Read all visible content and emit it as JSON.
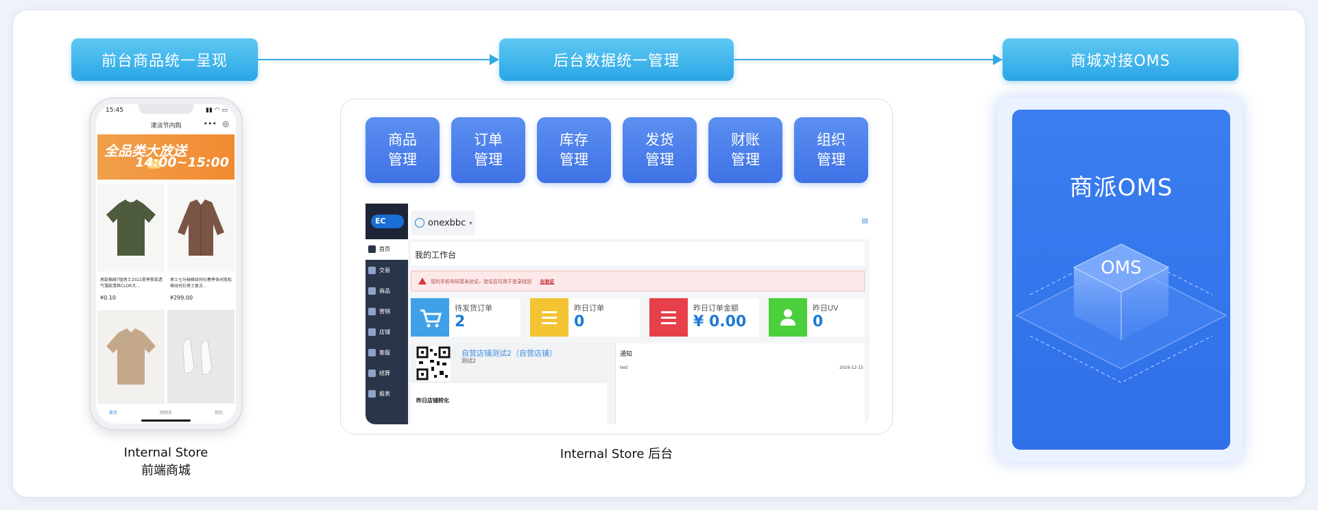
{
  "stages": {
    "frontend": "前台商品统一呈现",
    "backend": "后台数据统一管理",
    "oms": "商城对接OMS"
  },
  "phone": {
    "time": "15:45",
    "signal": "▮▮ ◠ ▭",
    "title": "津淡节内购",
    "banner_main": "全品类大放送",
    "banner_time": "14:00~15:00",
    "products": [
      {
        "desc": "男款棉麻T恤男士2022夏季新款透气薄款清爽CLOR大...",
        "price": "¥0.10"
      },
      {
        "desc": "男士七分袖格纹衬衫春季休闲宽松格纹衬衫男士复古...",
        "price": "¥299.00"
      },
      {
        "desc": "",
        "price": ""
      },
      {
        "desc": "",
        "price": ""
      }
    ],
    "tabs": [
      "首页",
      "购物车",
      "我的"
    ],
    "caption_line1": "Internal Store",
    "caption_line2": "前端商城"
  },
  "backend": {
    "modules": [
      "商品\n管理",
      "订单\n管理",
      "库存\n管理",
      "发货\n管理",
      "财账\n管理",
      "组织\n管理"
    ],
    "logo": "EC",
    "username": "onexbbc",
    "nav": [
      "首页",
      "交易",
      "商品",
      "营销",
      "店铺",
      "客服",
      "结算",
      "报表"
    ],
    "workbench_title": "我的工作台",
    "alert_text": "您的手机号码暂未验证，验证后可用于登录找回",
    "alert_link": "去验证",
    "stats": [
      {
        "label": "待发货订单",
        "value": "2",
        "color": "#3fa0e8"
      },
      {
        "label": "昨日订单",
        "value": "0",
        "color": "#f3c332"
      },
      {
        "label": "昨日订单金额",
        "value": "¥ 0.00",
        "color": "#e8404a"
      },
      {
        "label": "昨日UV",
        "value": "0",
        "color": "#4ccf3c"
      }
    ],
    "shop_name": "自营店铺测试2（自营店铺）",
    "shop_sub": "测试2",
    "shop_conversion": "昨日店铺转化",
    "notice_title": "通知",
    "notice_row": "test",
    "notice_date": "2016-12-15",
    "caption": "Internal Store 后台"
  },
  "oms": {
    "title": "商派OMS",
    "badge": "OMS"
  }
}
